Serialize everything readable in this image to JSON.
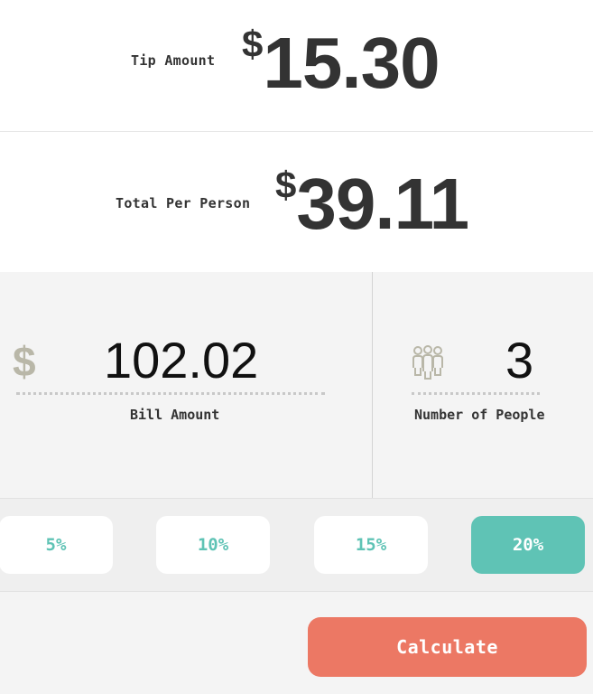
{
  "tip": {
    "label": "Tip Amount",
    "currency": "$",
    "value": "15.30"
  },
  "total": {
    "label": "Total Per Person",
    "currency": "$",
    "value": "39.11"
  },
  "bill": {
    "currency_icon": "$",
    "value": "102.02",
    "caption": "Bill Amount"
  },
  "people": {
    "icon": "people-icon",
    "value": "3",
    "caption": "Number of People"
  },
  "tip_options": [
    {
      "label": "5%",
      "selected": false
    },
    {
      "label": "10%",
      "selected": false
    },
    {
      "label": "15%",
      "selected": false
    },
    {
      "label": "20%",
      "selected": true
    }
  ],
  "calculate": {
    "label": "Calculate"
  },
  "colors": {
    "accent": "#5fc3b5",
    "calculate": "#ec7864",
    "icon": "#b9b7a8"
  }
}
